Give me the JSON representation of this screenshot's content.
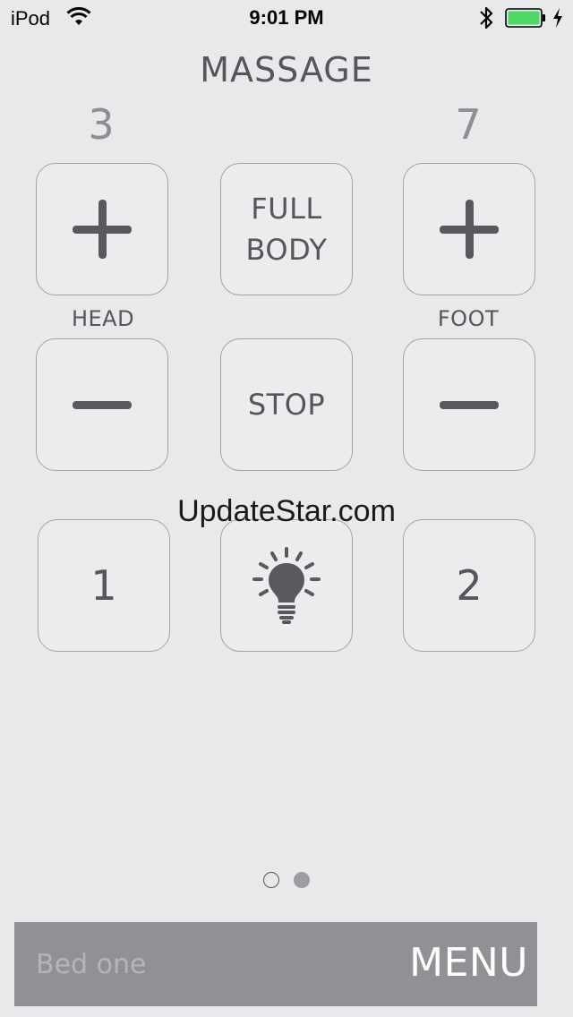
{
  "status_bar": {
    "carrier": "iPod",
    "time": "9:01 PM",
    "battery_color": "#4cd964"
  },
  "screen": {
    "title": "MASSAGE",
    "head_level": "3",
    "foot_level": "7",
    "head_label": "HEAD",
    "foot_label": "FOOT",
    "full_body_line1": "FULL",
    "full_body_line2": "BODY",
    "stop_label": "STOP",
    "preset_1": "1",
    "preset_2": "2",
    "watermark": "UpdateStar.com"
  },
  "pager": {
    "pages": 2,
    "current": 2
  },
  "bottom_bar": {
    "bed_name": "Bed one",
    "menu_label": "MENU"
  },
  "colors": {
    "background": "#e8e9eb",
    "button_border": "#a2a3a6",
    "icon": "#58595c",
    "bottom_bar": "#909194"
  }
}
